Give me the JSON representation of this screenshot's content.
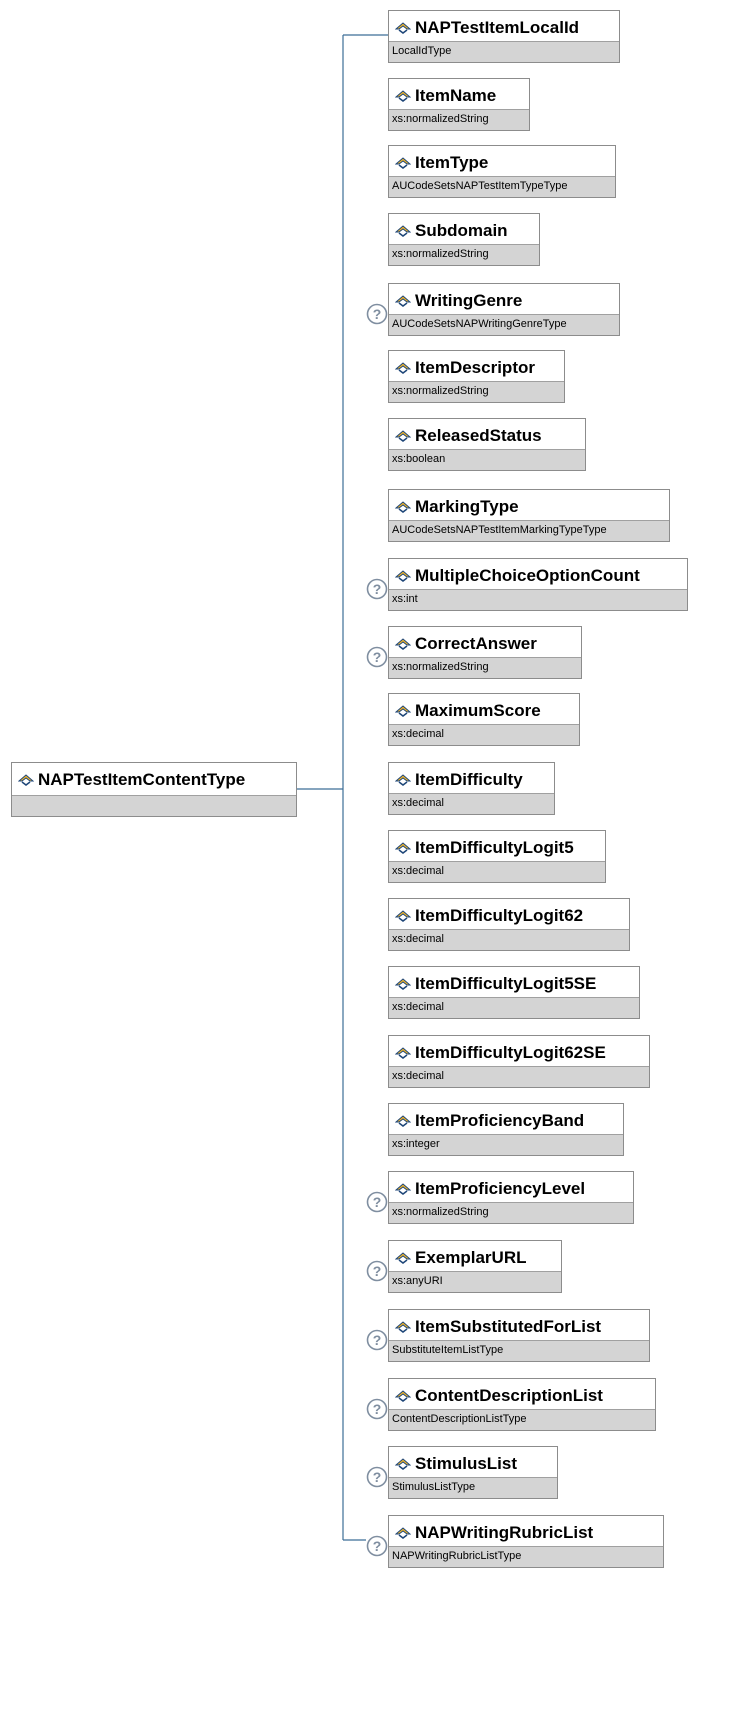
{
  "root": {
    "name": "NAPTestItemContentType"
  },
  "elements": [
    {
      "name": "NAPTestItemLocalId",
      "type": "LocalIdType",
      "optional": false
    },
    {
      "name": "ItemName",
      "type": "xs:normalizedString",
      "optional": false
    },
    {
      "name": "ItemType",
      "type": "AUCodeSetsNAPTestItemTypeType",
      "optional": false
    },
    {
      "name": "Subdomain",
      "type": "xs:normalizedString",
      "optional": false
    },
    {
      "name": "WritingGenre",
      "type": "AUCodeSetsNAPWritingGenreType",
      "optional": true
    },
    {
      "name": "ItemDescriptor",
      "type": "xs:normalizedString",
      "optional": false
    },
    {
      "name": "ReleasedStatus",
      "type": "xs:boolean",
      "optional": false
    },
    {
      "name": "MarkingType",
      "type": "AUCodeSetsNAPTestItemMarkingTypeType",
      "optional": false
    },
    {
      "name": "MultipleChoiceOptionCount",
      "type": "xs:int",
      "optional": true
    },
    {
      "name": "CorrectAnswer",
      "type": "xs:normalizedString",
      "optional": true
    },
    {
      "name": "MaximumScore",
      "type": "xs:decimal",
      "optional": false
    },
    {
      "name": "ItemDifficulty",
      "type": "xs:decimal",
      "optional": false
    },
    {
      "name": "ItemDifficultyLogit5",
      "type": "xs:decimal",
      "optional": false
    },
    {
      "name": "ItemDifficultyLogit62",
      "type": "xs:decimal",
      "optional": false
    },
    {
      "name": "ItemDifficultyLogit5SE",
      "type": "xs:decimal",
      "optional": false
    },
    {
      "name": "ItemDifficultyLogit62SE",
      "type": "xs:decimal",
      "optional": false
    },
    {
      "name": "ItemProficiencyBand",
      "type": "xs:integer",
      "optional": false
    },
    {
      "name": "ItemProficiencyLevel",
      "type": "xs:normalizedString",
      "optional": true
    },
    {
      "name": "ExemplarURL",
      "type": "xs:anyURI",
      "optional": true
    },
    {
      "name": "ItemSubstitutedForList",
      "type": "SubstituteItemListType",
      "optional": true
    },
    {
      "name": "ContentDescriptionList",
      "type": "ContentDescriptionListType",
      "optional": true
    },
    {
      "name": "StimulusList",
      "type": "StimulusListType",
      "optional": true
    },
    {
      "name": "NAPWritingRubricList",
      "type": "NAPWritingRubricListType",
      "optional": true
    }
  ],
  "colors": {
    "connector": "#3c6e96",
    "icon_fill": "#f0b428",
    "icon_stroke": "#1e4678",
    "type_bar": "#d4d4d4",
    "optional_badge": "#7f8ea0"
  },
  "icons": {
    "element": "element-diamond-icon",
    "optional": "question-mark-icon"
  }
}
